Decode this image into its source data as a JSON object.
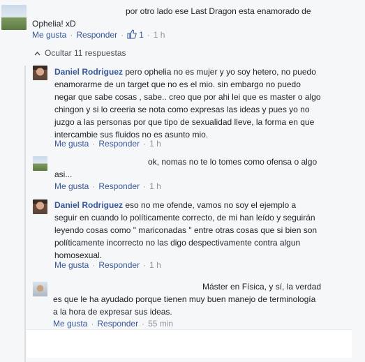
{
  "top_comment": {
    "text_line1": "por otro lado ese Last Dragon esta enamorado de",
    "text_line2": "Ophelia! xD",
    "actions": {
      "like": "Me gusta",
      "reply": "Responder",
      "likes_count": "1",
      "time": "1 h"
    }
  },
  "replies_toggle": "Ocultar 11 respuestas",
  "replies": [
    {
      "author": "Daniel Rodriguez",
      "lines": [
        "pero ophelia no es mujer y yo soy hetero, no puedo",
        "enamorarme de un target que no es el mio. sin embargo no puedo",
        "negar que sabe cosas , sabe.. creo que por ahi lei que es master o algo",
        "chingon y si lo creeria se nota como expresas las ideas y pues yo no",
        "juzgo a las personas por que tipo de sexualidad lleve, la forma en que",
        "intercambie sus fluidos no es asunto mio."
      ],
      "actions": {
        "like": "Me gusta",
        "reply": "Responder",
        "time": "1 h"
      }
    },
    {
      "author": "",
      "lines": [
        "ok, nomas no te lo tomes como ofensa o algo",
        "asi..."
      ],
      "actions": {
        "like": "Me gusta",
        "reply": "Responder",
        "time": "1 h"
      }
    },
    {
      "author": "Daniel Rodriguez",
      "lines": [
        "eso no me ofende, vamos no soy el ejemplo a",
        "seguir en cuando lo políticamente correcto, de mi han leído y seguirán",
        "leyendo cosas como \" mariconadas \" entre otras cosas que si bien son",
        "políticamente incorrecto no las digo despectivamente contra algun",
        "homosexual."
      ],
      "actions": {
        "like": "Me gusta",
        "reply": "Responder",
        "time": "1 h"
      }
    },
    {
      "author": "",
      "lines": [
        "Máster en Física, y sí, la verdad",
        "es que le ha ayudado porque tienen muy buen manejo de terminología",
        "a la hora de expresar sus ideas."
      ],
      "actions": {
        "like": "Me gusta",
        "reply": "Responder",
        "time": "55 min"
      }
    }
  ],
  "colors": {
    "link": "#365899",
    "meta": "#90949c",
    "background": "#f6f7f9"
  },
  "icons": {
    "like_badge": "thumbs-up-icon",
    "toggle": "chevron-up-icon"
  }
}
